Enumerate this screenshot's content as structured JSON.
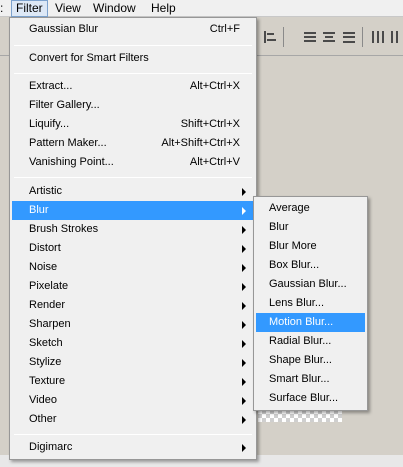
{
  "menubar": {
    "items": [
      {
        "label": "Filter"
      },
      {
        "label": "View"
      },
      {
        "label": "Window"
      },
      {
        "label": "Help"
      }
    ]
  },
  "toolbar": {
    "icons": [
      "align-left-icon",
      "align-top-icon",
      "align-vcenter-icon",
      "align-bottom-icon",
      "align-hcenter-icon"
    ]
  },
  "filter_menu": {
    "last_filter": {
      "label": "Gaussian Blur",
      "shortcut": "Ctrl+F"
    },
    "convert": {
      "label": "Convert for Smart Filters"
    },
    "group1": [
      {
        "label": "Extract...",
        "shortcut": "Alt+Ctrl+X"
      },
      {
        "label": "Filter Gallery...",
        "shortcut": ""
      },
      {
        "label": "Liquify...",
        "shortcut": "Shift+Ctrl+X"
      },
      {
        "label": "Pattern Maker...",
        "shortcut": "Alt+Shift+Ctrl+X"
      },
      {
        "label": "Vanishing Point...",
        "shortcut": "Alt+Ctrl+V"
      }
    ],
    "submenus": [
      {
        "label": "Artistic"
      },
      {
        "label": "Blur"
      },
      {
        "label": "Brush Strokes"
      },
      {
        "label": "Distort"
      },
      {
        "label": "Noise"
      },
      {
        "label": "Pixelate"
      },
      {
        "label": "Render"
      },
      {
        "label": "Sharpen"
      },
      {
        "label": "Sketch"
      },
      {
        "label": "Stylize"
      },
      {
        "label": "Texture"
      },
      {
        "label": "Video"
      },
      {
        "label": "Other"
      }
    ],
    "digimarc": {
      "label": "Digimarc"
    },
    "highlighted": "Blur"
  },
  "blur_submenu": {
    "items": [
      {
        "label": "Average"
      },
      {
        "label": "Blur"
      },
      {
        "label": "Blur More"
      },
      {
        "label": "Box Blur..."
      },
      {
        "label": "Gaussian Blur..."
      },
      {
        "label": "Lens Blur..."
      },
      {
        "label": "Motion Blur..."
      },
      {
        "label": "Radial Blur..."
      },
      {
        "label": "Shape Blur..."
      },
      {
        "label": "Smart Blur..."
      },
      {
        "label": "Surface Blur..."
      }
    ],
    "highlighted": "Motion Blur...",
    "highlight_color": "#3399ff"
  }
}
